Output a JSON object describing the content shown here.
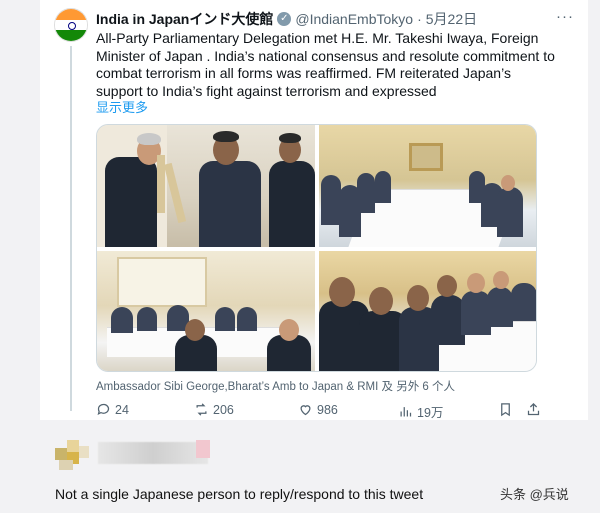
{
  "tweet": {
    "author_name": "India in Japanインド大使館",
    "handle": "@IndianEmbTokyo",
    "separator": "·",
    "date": "5月22日",
    "text": "All-Party Parliamentary Delegation met  H.E. Mr. Takeshi Iwaya, Foreign Minister of Japan . India’s national consensus and resolute commitment to combat terrorism in all forms was reaffirmed. FM reiterated Japan’s support to India’s fight against terrorism and expressed",
    "show_more": "显示更多",
    "tagged": "Ambassador Sibi George,Bharat’s Amb to Japan & RMI 及 另外 6 个人",
    "more_icon": "more-dots-icon",
    "verified_icon": "verified-badge-icon",
    "colors": {
      "link": "#1d9bf0",
      "muted": "#536471",
      "flag_saffron": "#ff9933",
      "flag_green": "#138808"
    }
  },
  "actions": {
    "reply_count": "24",
    "retweet_count": "206",
    "like_count": "986",
    "views_count": "19万"
  },
  "reply": {
    "comment": "Not a single Japanese person to reply/respond to this tweet"
  },
  "watermark": {
    "text": "头条 @兵说"
  }
}
